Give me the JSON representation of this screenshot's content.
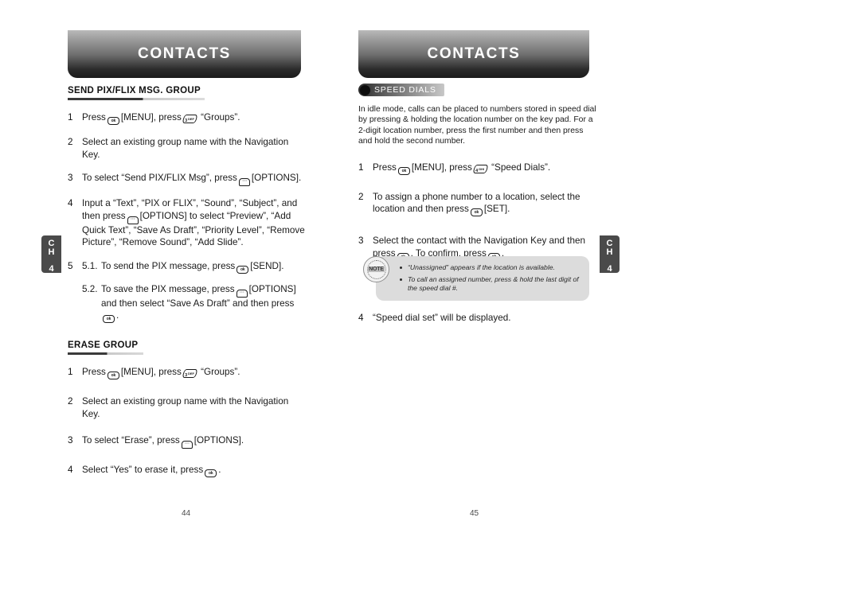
{
  "left_page": {
    "banner_title": "CONTACTS",
    "chapter_tab": {
      "line1": "C",
      "line2": "H",
      "number": "4"
    },
    "page_number": "44",
    "sections": [
      {
        "heading": "SEND PIX/FLIX MSG. GROUP",
        "steps": [
          {
            "num": "1",
            "text_a": "Press",
            "key1": "ok",
            "text_b": "[MENU], press",
            "key2": "3",
            "key2_sub": "DEF",
            "text_c": "“Groups”."
          },
          {
            "num": "2",
            "text": "Select an existing group name with the Navigation Key."
          },
          {
            "num": "3",
            "text_a": "To select “Send PIX/FLIX Msg”, press",
            "key1": "options",
            "text_b": "[OPTIONS]."
          },
          {
            "num": "4",
            "text_a": "Input a “Text”, “PIX or FLIX”, “Sound”, “Subject”, and then press",
            "key1": "options",
            "text_b": "[OPTIONS] to select “Preview”, “Add Quick Text”, “Save As Draft”, “Priority Level”, “Remove Picture”, “Remove Sound”, “Add Slide”."
          },
          {
            "num": "5",
            "sub1_label": "5.1.",
            "sub1_a": "To send the PIX message, press",
            "sub1_key": "ok",
            "sub1_b": "[SEND].",
            "sub2_label": "5.2.",
            "sub2_a": "To save the PIX message, press",
            "sub2_key": "options",
            "sub2_b": "[OPTIONS] and then select “Save As Draft” and then press",
            "sub2_key2": "ok",
            "sub2_c": "."
          }
        ]
      },
      {
        "heading": "ERASE GROUP",
        "steps": [
          {
            "num": "1",
            "text_a": "Press",
            "key1": "ok",
            "text_b": "[MENU], press",
            "key2": "3",
            "key2_sub": "DEF",
            "text_c": "“Groups”."
          },
          {
            "num": "2",
            "text": "Select an existing group name with the Navigation Key."
          },
          {
            "num": "3",
            "text_a": "To select “Erase”, press",
            "key1": "options",
            "text_b": "[OPTIONS]."
          },
          {
            "num": "4",
            "text_a": "Select “Yes” to erase it, press",
            "key1": "ok",
            "text_b": "."
          }
        ]
      }
    ]
  },
  "right_page": {
    "banner_title": "CONTACTS",
    "chapter_tab": {
      "line1": "C",
      "line2": "H",
      "number": "4"
    },
    "page_number": "45",
    "badge_label": "SPEED DIALS",
    "intro": "In idle mode, calls can be placed to numbers stored in speed dial by pressing & holding the location number on the key pad. For a 2-digit location number, press the first number and then press and hold the second number.",
    "steps": [
      {
        "num": "1",
        "text_a": "Press",
        "key1": "ok",
        "text_b": "[MENU], press",
        "key2": "4",
        "key2_sub": "GHI",
        "text_c": "“Speed Dials”."
      },
      {
        "num": "2",
        "text_a": "To assign a phone number to a location, select the location and then press",
        "key1": "ok",
        "text_b": "[SET]."
      },
      {
        "num": "3",
        "text_a": "Select the contact with the Navigation Key and then press",
        "key1": "ok",
        "text_b": ". To confirm, press",
        "key2": "ok",
        "text_c": "."
      },
      {
        "num": "4",
        "text": "“Speed dial set” will be displayed."
      }
    ],
    "note": {
      "stamp_label": "NOTE",
      "items": [
        "“Unassigned” appears if the location is available.",
        "To call an assigned number, press & hold the last digit of the speed dial #."
      ]
    }
  },
  "colors": {
    "banner_dark": "#1b1b1b",
    "banner_light": "#b9b9b9",
    "tab_bg": "#4a4a4a",
    "note_bg": "#dcdcdc"
  }
}
